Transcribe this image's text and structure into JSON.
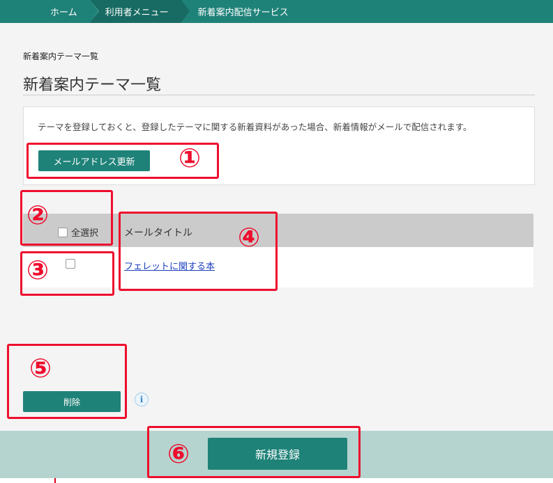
{
  "breadcrumb": {
    "items": [
      "ホーム",
      "利用者メニュー",
      "新着案内配信サービス"
    ]
  },
  "page": {
    "small_title": "新着案内テーマ一覧",
    "title": "新着案内テーマ一覧"
  },
  "info": {
    "text": "テーマを登録しておくと、登録したテーマに関する新着資料があった場合、新着情報がメールで配信されます。",
    "mail_button": "メールアドレス更新"
  },
  "table": {
    "select_all_label": "全選択",
    "column_header": "メールタイトル",
    "rows": [
      {
        "title": "フェレットに関する本"
      }
    ]
  },
  "actions": {
    "delete_button": "削除",
    "info_icon": "i",
    "new_button": "新規登録"
  },
  "annotations": [
    "①",
    "②",
    "③",
    "④",
    "⑤",
    "⑥"
  ],
  "colors": {
    "accent": "#1f8278",
    "annotation": "#ee0d2d",
    "footer": "#b5d4cf",
    "link": "#1a3ec0"
  }
}
